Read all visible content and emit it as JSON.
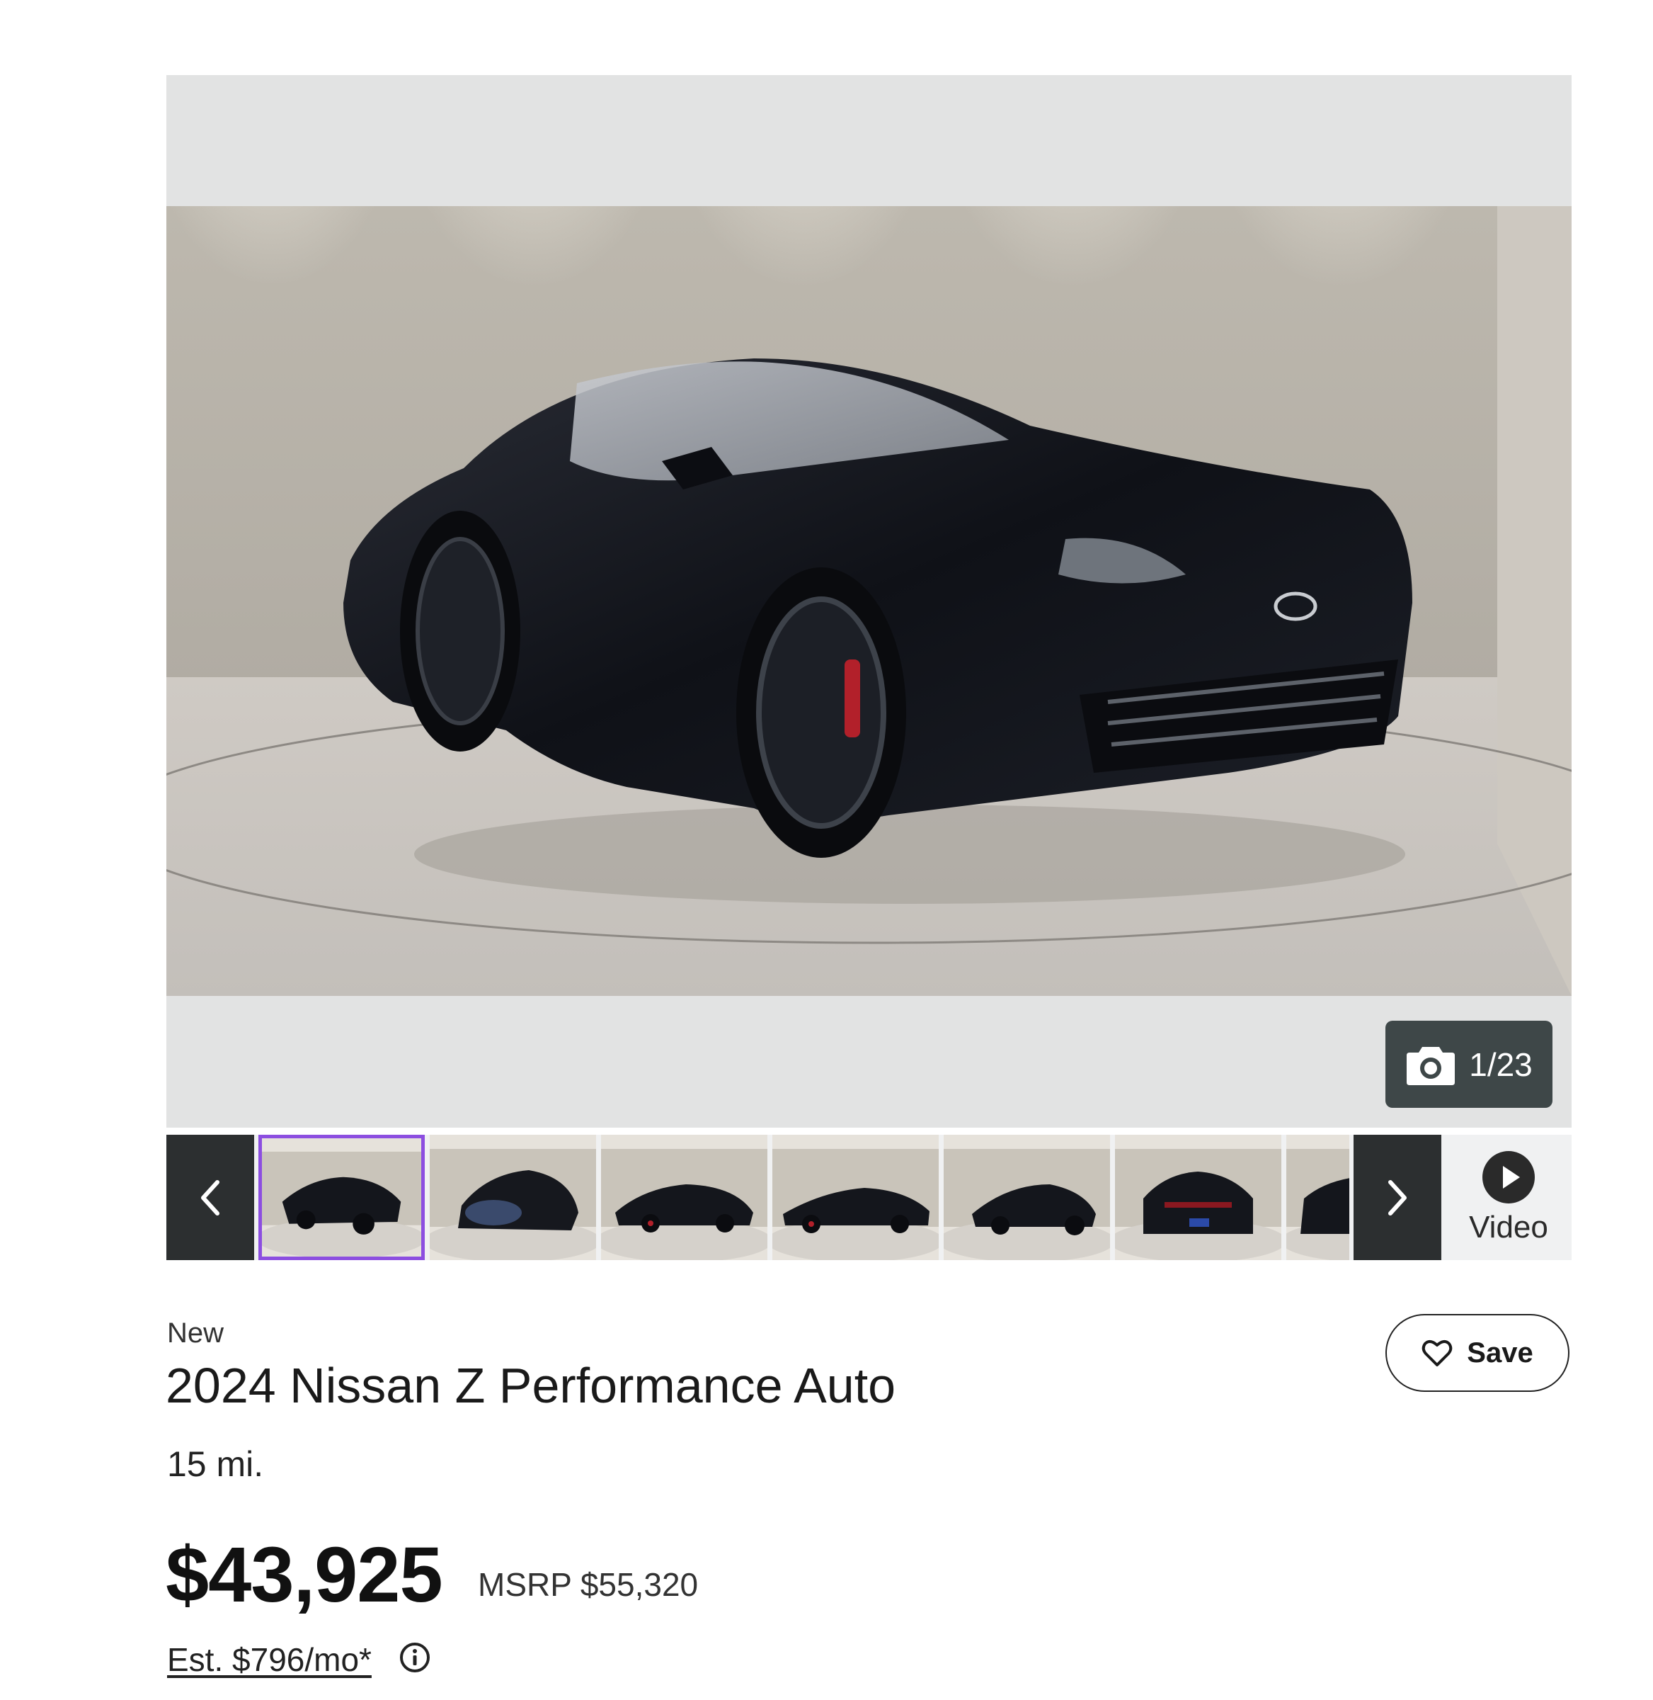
{
  "gallery": {
    "counter_text": "1/23",
    "counter_icon": "camera-icon",
    "thumbnail_count_visible": 7,
    "active_thumbnail": 1,
    "video_label": "Video"
  },
  "listing": {
    "condition": "New",
    "title": "2024 Nissan Z Performance Auto",
    "mileage": "15 mi.",
    "price": "$43,925",
    "msrp": "MSRP $55,320",
    "estimate": "Est. $796/mo*",
    "save_label": "Save"
  },
  "colors": {
    "accent_active_thumb": "#8c4ee0",
    "counter_bg": "#3e4748",
    "nav_bg": "#2c2f30"
  }
}
